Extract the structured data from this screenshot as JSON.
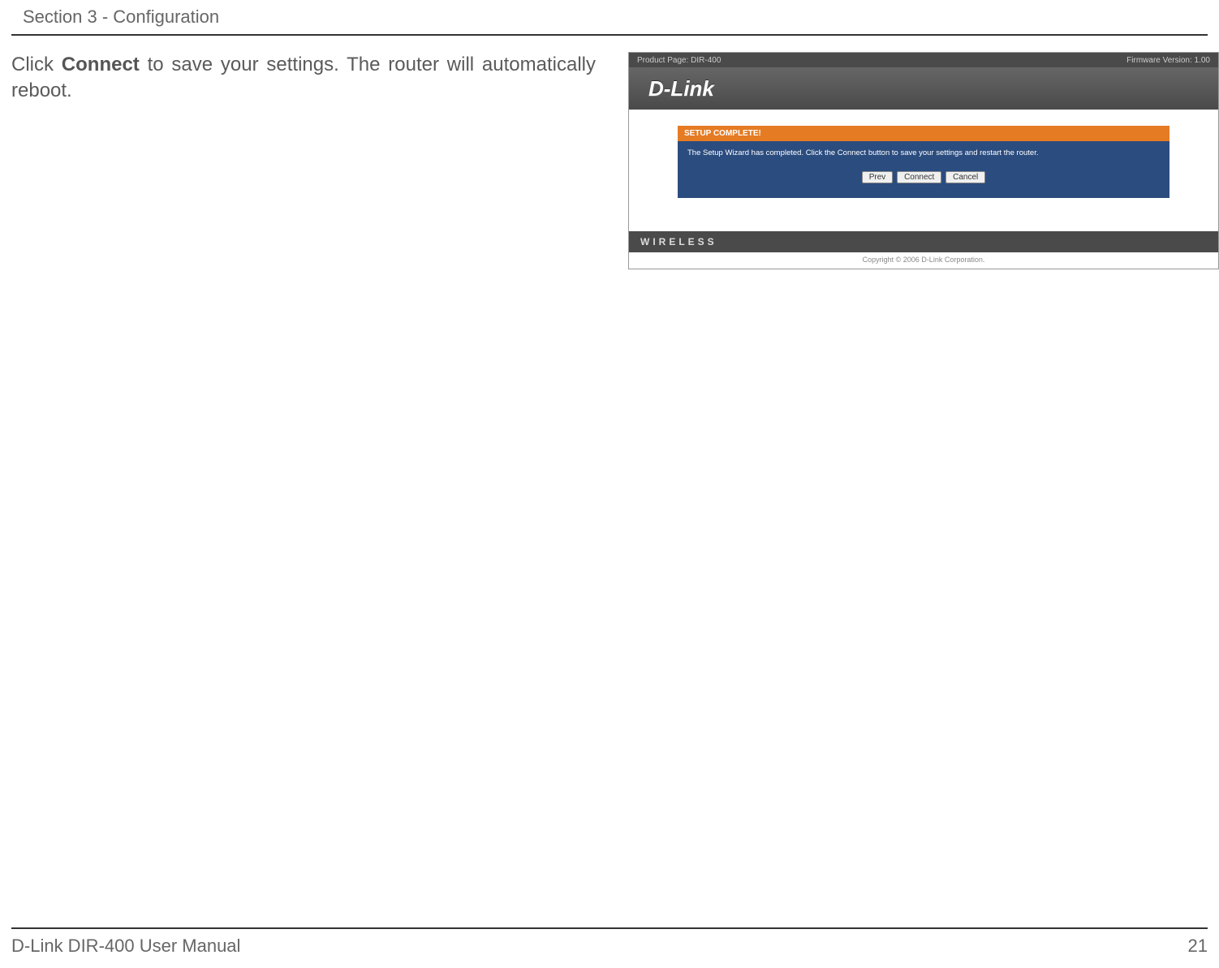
{
  "header": {
    "section_label": "Section 3 - Configuration"
  },
  "instruction": {
    "prefix": "Click ",
    "bold": "Connect",
    "suffix": " to save your settings. The router will automatically reboot."
  },
  "screenshot": {
    "top_bar": {
      "left": "Product Page: DIR-400",
      "right": "Firmware Version: 1.00"
    },
    "logo": "D-Link",
    "panel": {
      "title": "SETUP COMPLETE!",
      "message": "The Setup Wizard has completed. Click the Connect button to save your settings and restart the router.",
      "buttons": {
        "prev": "Prev",
        "connect": "Connect",
        "cancel": "Cancel"
      }
    },
    "bottom_bar": "WIRELESS",
    "copyright": "Copyright © 2006 D-Link Corporation."
  },
  "footer": {
    "left": "D-Link DIR-400 User Manual",
    "right": "21"
  }
}
